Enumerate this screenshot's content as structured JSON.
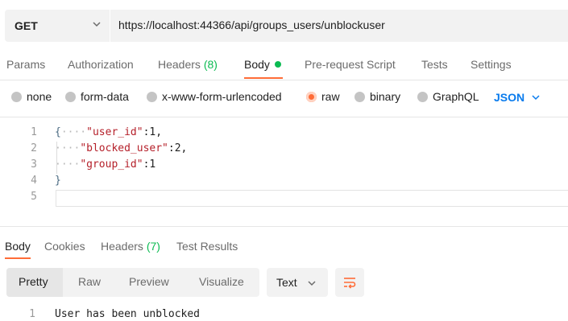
{
  "request": {
    "method": "GET",
    "url": "https://localhost:44366/api/groups_users/unblockuser"
  },
  "request_tabs": [
    {
      "label": "Params"
    },
    {
      "label": "Authorization"
    },
    {
      "label": "Headers",
      "count": "(8)"
    },
    {
      "label": "Body",
      "active": true,
      "has_dot": true
    },
    {
      "label": "Pre-request Script"
    },
    {
      "label": "Tests"
    },
    {
      "label": "Settings"
    }
  ],
  "body_types": [
    {
      "label": "none"
    },
    {
      "label": "form-data"
    },
    {
      "label": "x-www-form-urlencoded"
    },
    {
      "label": "raw",
      "selected": true
    },
    {
      "label": "binary"
    },
    {
      "label": "GraphQL"
    }
  ],
  "body_format": "JSON",
  "editor": {
    "lines": [
      {
        "number": "1",
        "text": "{····\"user_id\":1,"
      },
      {
        "number": "2",
        "text": "····\"blocked_user\":2,"
      },
      {
        "number": "3",
        "text": "····\"group_id\":1"
      },
      {
        "number": "4",
        "text": "}"
      },
      {
        "number": "5",
        "text": ""
      }
    ]
  },
  "response_tabs": [
    {
      "label": "Body",
      "active": true
    },
    {
      "label": "Cookies"
    },
    {
      "label": "Headers",
      "count": "(7)"
    },
    {
      "label": "Test Results"
    }
  ],
  "response_views": [
    "Pretty",
    "Raw",
    "Preview",
    "Visualize"
  ],
  "response_format": "Text",
  "response_body": [
    {
      "number": "1",
      "text": "User has been unblocked"
    }
  ],
  "colors": {
    "accent": "#ff6c37",
    "json_blue": "#097bed",
    "count_green": "#0cbb52",
    "string_red": "#b5202a"
  },
  "icons": [
    "chevron-down-icon",
    "status-dot-icon",
    "radio-icon",
    "word-wrap-icon"
  ]
}
